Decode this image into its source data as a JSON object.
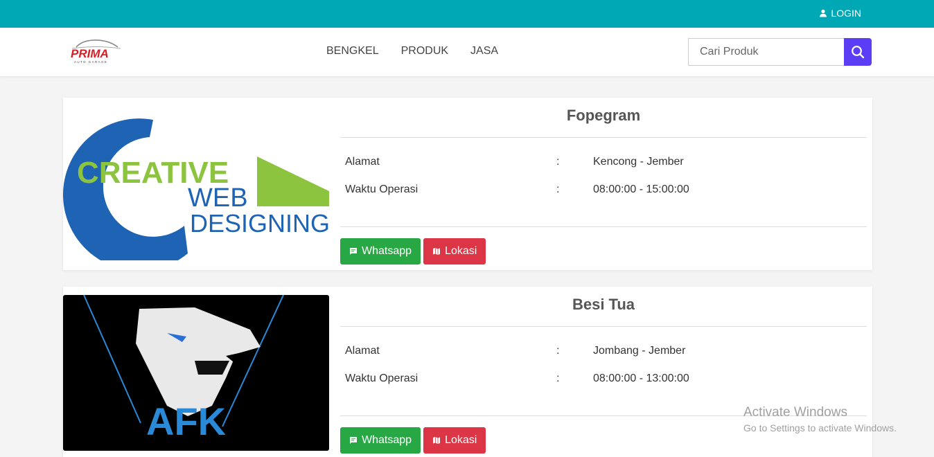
{
  "topbar": {
    "login_label": "LOGIN",
    "color": "#00a8b5"
  },
  "brand": {
    "logo_text": "PRIMA",
    "logo_sub": "AUTO GARAGE"
  },
  "nav": {
    "items": [
      "BENGKEL",
      "PRODUK",
      "JASA"
    ]
  },
  "search": {
    "placeholder": "Cari Produk",
    "icon": "search-icon",
    "button_color": "#5b3df5"
  },
  "cards": [
    {
      "title": "Fopegram",
      "image": {
        "line1": "CREATIVE",
        "line2": "WEB",
        "line3": "DESIGNING"
      },
      "address_label": "Alamat",
      "address": "Kencong - Jember",
      "hours_label": "Waktu Operasi",
      "hours": "08:00:00 - 15:00:00",
      "colon": ":",
      "whatsapp_label": "Whatsapp",
      "lokasi_label": "Lokasi"
    },
    {
      "title": "Besi Tua",
      "image": {
        "text": "AFK"
      },
      "address_label": "Alamat",
      "address": "Jombang - Jember",
      "hours_label": "Waktu Operasi",
      "hours": "08:00:00 - 13:00:00",
      "colon": ":",
      "whatsapp_label": "Whatsapp",
      "lokasi_label": "Lokasi"
    }
  ],
  "colors": {
    "whatsapp": "#28a745",
    "lokasi": "#dc3545"
  },
  "watermark": {
    "line1": "Activate Windows",
    "line2": "Go to Settings to activate Windows."
  }
}
